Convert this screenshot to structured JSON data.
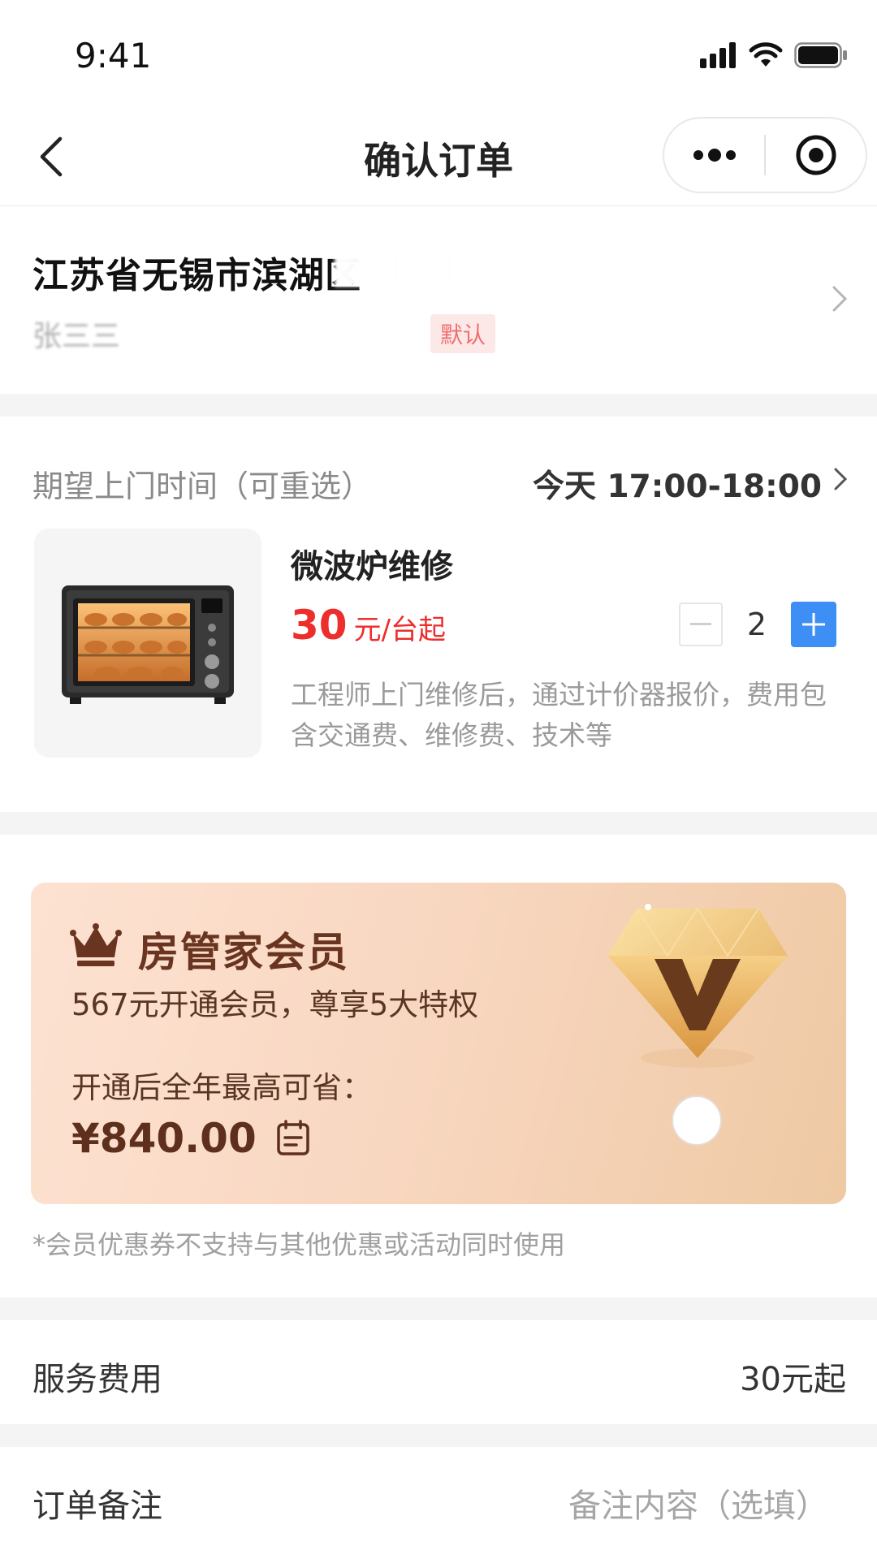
{
  "status_bar": {
    "time": "9:41"
  },
  "nav": {
    "title": "确认订单"
  },
  "address": {
    "line": "江苏省无锡市滨湖区",
    "contact_name": "张三三",
    "default_badge": "默认"
  },
  "service": {
    "time_label": "期望上门时间（可重选）",
    "time_value": "今天 17:00-18:00",
    "product_name": "微波炉维修",
    "price_number": "30",
    "price_unit": "元/台起",
    "quantity": "2",
    "description": "工程师上门维修后，通过计价器报价，费用包含交通费、维修费、技术等"
  },
  "member": {
    "title": "房管家会员",
    "offer": "567元开通会员，尊享5大特权",
    "save_label": "开通后全年最高可省：",
    "save_amount": "¥840.00",
    "note": "*会员优惠券不支持与其他优惠或活动同时使用"
  },
  "fees": {
    "label": "服务费用",
    "value": "30元起"
  },
  "remark": {
    "label": "订单备注",
    "placeholder": "备注内容（选填）"
  },
  "colors": {
    "accent_blue": "#3d8ff5",
    "price_red": "#ee2d2d",
    "member_brown": "#6a3520"
  }
}
